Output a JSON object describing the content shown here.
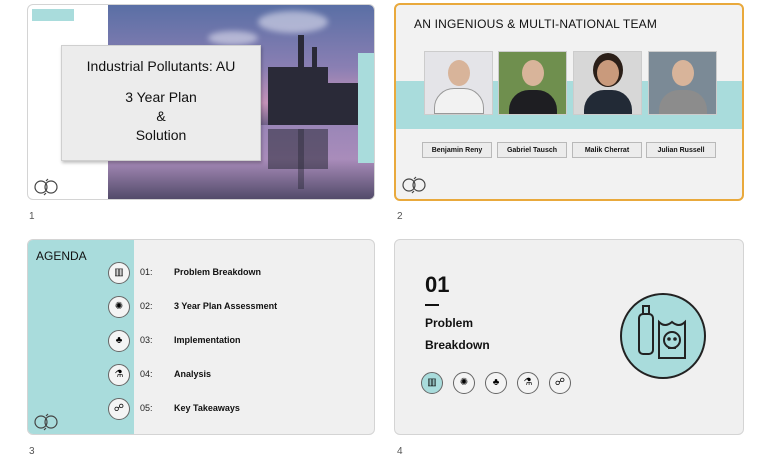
{
  "slides": [
    {
      "number": "1",
      "title_line1": "Industrial Pollutants: AU",
      "title_line2": "3 Year Plan\n&\nSolution",
      "logo_icon": "recycle-arrows-icon"
    },
    {
      "number": "2",
      "title": "AN INGENIOUS & MULTI-NATIONAL TEAM",
      "members": [
        {
          "name": "Benjamin Reny"
        },
        {
          "name": "Gabriel Tausch"
        },
        {
          "name": "Malik Cherrat"
        },
        {
          "name": "Julian Russell"
        }
      ],
      "logo_icon": "recycle-arrows-icon"
    },
    {
      "number": "3",
      "heading": "AGENDA",
      "items": [
        {
          "num": "01:",
          "label": "Problem Breakdown",
          "icon": "factory-icon"
        },
        {
          "num": "02:",
          "label": "3 Year Plan Assessment",
          "icon": "virus-icon"
        },
        {
          "num": "03:",
          "label": "Implementation",
          "icon": "hand-plant-icon"
        },
        {
          "num": "04:",
          "label": "Analysis",
          "icon": "analysis-icon"
        },
        {
          "num": "05:",
          "label": "Key Takeaways",
          "icon": "people-network-icon"
        }
      ],
      "logo_icon": "recycle-arrows-icon"
    },
    {
      "number": "4",
      "big_number": "01",
      "heading": "Problem\nBreakdown",
      "section_icon": "plastic-pollution-skull-icon"
    }
  ],
  "colors": {
    "accent_teal": "#a9dcdc",
    "selected_border": "#e9a93c"
  }
}
